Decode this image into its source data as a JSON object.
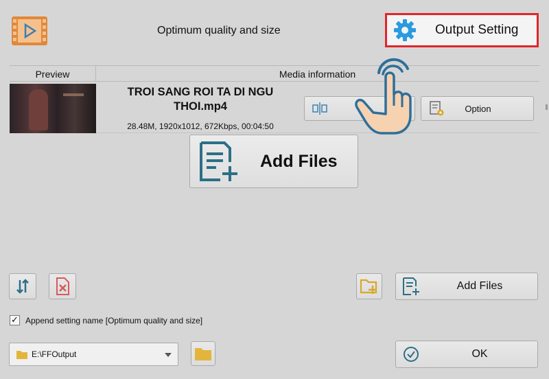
{
  "header": {
    "preset_title": "Optimum quality and size",
    "output_setting_label": "Output Setting"
  },
  "table": {
    "col_preview": "Preview",
    "col_media_info": "Media information"
  },
  "file": {
    "name": "TROI SANG ROI TA DI NGU THOI.mp4",
    "details": "28.48M, 1920x1012, 672Kbps, 00:04:50",
    "option_label": "Option"
  },
  "add_files_big_label": "Add Files",
  "add_files_label": "Add Files",
  "append": {
    "checked": true,
    "label": "Append setting name [Optimum quality and size]"
  },
  "output_folder": {
    "value": "E:\\FFOutput"
  },
  "ok_label": "OK",
  "colors": {
    "background": "#d6d6d6",
    "highlight_border": "#e0262b",
    "gear_blue": "#2a9be0",
    "icon_teal": "#2b6f86",
    "folder_yellow": "#e3b53c",
    "delete_red": "#d65a5a"
  }
}
